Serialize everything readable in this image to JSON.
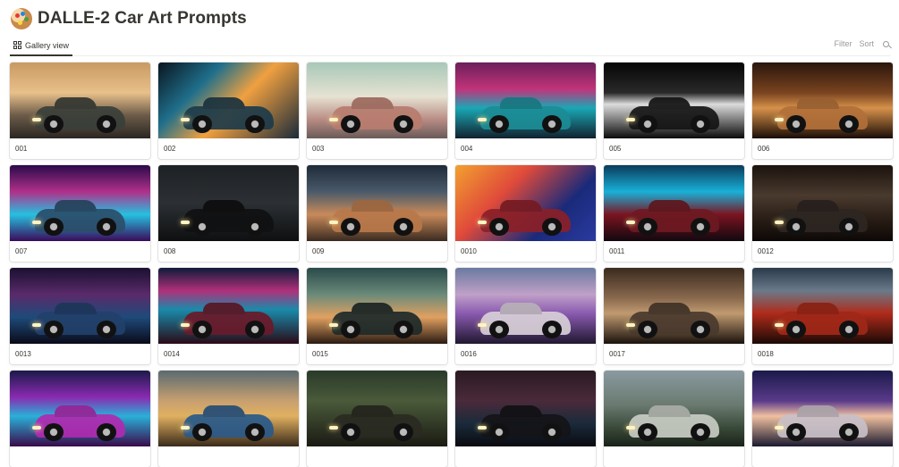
{
  "page": {
    "icon": "artist-palette-icon",
    "title": "DALLE-2 Car Art Prompts"
  },
  "toolbar": {
    "view_tab": "Gallery view",
    "filter_label": "Filter",
    "sort_label": "Sort",
    "search_icon": "search-icon"
  },
  "cards": [
    {
      "label": "001",
      "bg": "linear-gradient(180deg,#c99a63 0%,#e8c08a 40%,#6b5a48 70%,#2a2622 100%)",
      "car": "#3a3f3a"
    },
    {
      "label": "002",
      "bg": "linear-gradient(135deg,#0a1520 0%,#1f6f8b 30%,#f0a040 55%,#1a2a3a 100%)",
      "car": "#1d3b4a"
    },
    {
      "label": "003",
      "bg": "linear-gradient(180deg,#a8c8b8 0%,#e6e2d2 45%,#b98c84 75%,#6a5a58 100%)",
      "car": "#b77c6e"
    },
    {
      "label": "004",
      "bg": "linear-gradient(180deg,#6b1f5a 0%,#c2337a 35%,#1aa7b5 60%,#12212e 100%)",
      "car": "#1c8c95"
    },
    {
      "label": "005",
      "bg": "linear-gradient(180deg,#050505 0%,#2a2a2a 40%,#dcdcdc 55%,#0a0a0a 100%)",
      "car": "#151515"
    },
    {
      "label": "006",
      "bg": "linear-gradient(180deg,#2a160c 0%,#7a4420 40%,#d6914a 60%,#1a0c06 100%)",
      "car": "#b2703a"
    },
    {
      "label": "007",
      "bg": "linear-gradient(180deg,#2a0a4a 0%,#b0308a 35%,#26c0e0 65%,#3a0a5a 100%)",
      "car": "#2b4e6a"
    },
    {
      "label": "008",
      "bg": "linear-gradient(180deg,#1e2124 0%,#2c3034 50%,#0e0f10 100%)",
      "car": "#101112"
    },
    {
      "label": "009",
      "bg": "linear-gradient(180deg,#1e2a3a 0%,#4a5a6a 35%,#c88a5a 65%,#3a2a20 100%)",
      "car": "#b8784a"
    },
    {
      "label": "0010",
      "bg": "linear-gradient(135deg,#f2a030 0%,#e04a3a 35%,#1a2a7a 70%,#2a3aa0 100%)",
      "car": "#8a2028"
    },
    {
      "label": "0011",
      "bg": "linear-gradient(180deg,#0a3a5a 0%,#1ab0d8 35%,#7a1420 65%,#120810 100%)",
      "car": "#6e1a22"
    },
    {
      "label": "0012",
      "bg": "linear-gradient(180deg,#1a120c 0%,#4a3a2e 40%,#2a1e16 70%,#0c0806 100%)",
      "car": "#2e2622"
    },
    {
      "label": "0013",
      "bg": "linear-gradient(180deg,#1a1030 0%,#5a2a6a 35%,#1e4a7a 65%,#0a0a18 100%)",
      "car": "#22406a"
    },
    {
      "label": "0014",
      "bg": "linear-gradient(180deg,#0e1a3a 0%,#b0307a 30%,#1a8aaa 55%,#2a0a16 100%)",
      "car": "#6a1a2a"
    },
    {
      "label": "0015",
      "bg": "linear-gradient(180deg,#2a4a4a 0%,#6a8a7a 35%,#e0a060 65%,#2a1a12 100%)",
      "car": "#1e2a2a"
    },
    {
      "label": "0016",
      "bg": "linear-gradient(180deg,#6a7aa0 0%,#c0a0c8 35%,#8a5ab0 60%,#201830 100%)",
      "car": "#d8d0d8"
    },
    {
      "label": "0017",
      "bg": "linear-gradient(180deg,#3a2a1e 0%,#8a6a4e 40%,#c09a70 60%,#1a120c 100%)",
      "car": "#4a3a2e"
    },
    {
      "label": "0018",
      "bg": "linear-gradient(180deg,#2a3a4a 0%,#6a7a8a 30%,#b02a1a 60%,#1a0a06 100%)",
      "car": "#a02818"
    },
    {
      "label": "",
      "bg": "linear-gradient(180deg,#1a1a4a 0%,#8a2ab0 35%,#2ab0d8 60%,#3a0a4a 100%)",
      "car": "#b02ab0"
    },
    {
      "label": "",
      "bg": "linear-gradient(180deg,#5a6a70 0%,#c8a070 40%,#e0b060 60%,#3a2a1a 100%)",
      "car": "#2a5a8a"
    },
    {
      "label": "",
      "bg": "linear-gradient(180deg,#2a3a2a 0%,#4a5a3a 40%,#1a1a12 100%)",
      "car": "#2a2a22"
    },
    {
      "label": "",
      "bg": "linear-gradient(180deg,#2a1a22 0%,#4a2a3a 40%,#1a2a3a 70%,#0a0a10 100%)",
      "car": "#141418"
    },
    {
      "label": "",
      "bg": "linear-gradient(180deg,#8a9aa0 0%,#6a7a70 45%,#3a4a3a 75%,#1a2218 100%)",
      "car": "#c8ccc4"
    },
    {
      "label": "",
      "bg": "linear-gradient(180deg,#1a1a4a 0%,#5a3a8a 40%,#f0c0a0 60%,#1a1a30 100%)",
      "car": "#c8c0c8"
    }
  ]
}
